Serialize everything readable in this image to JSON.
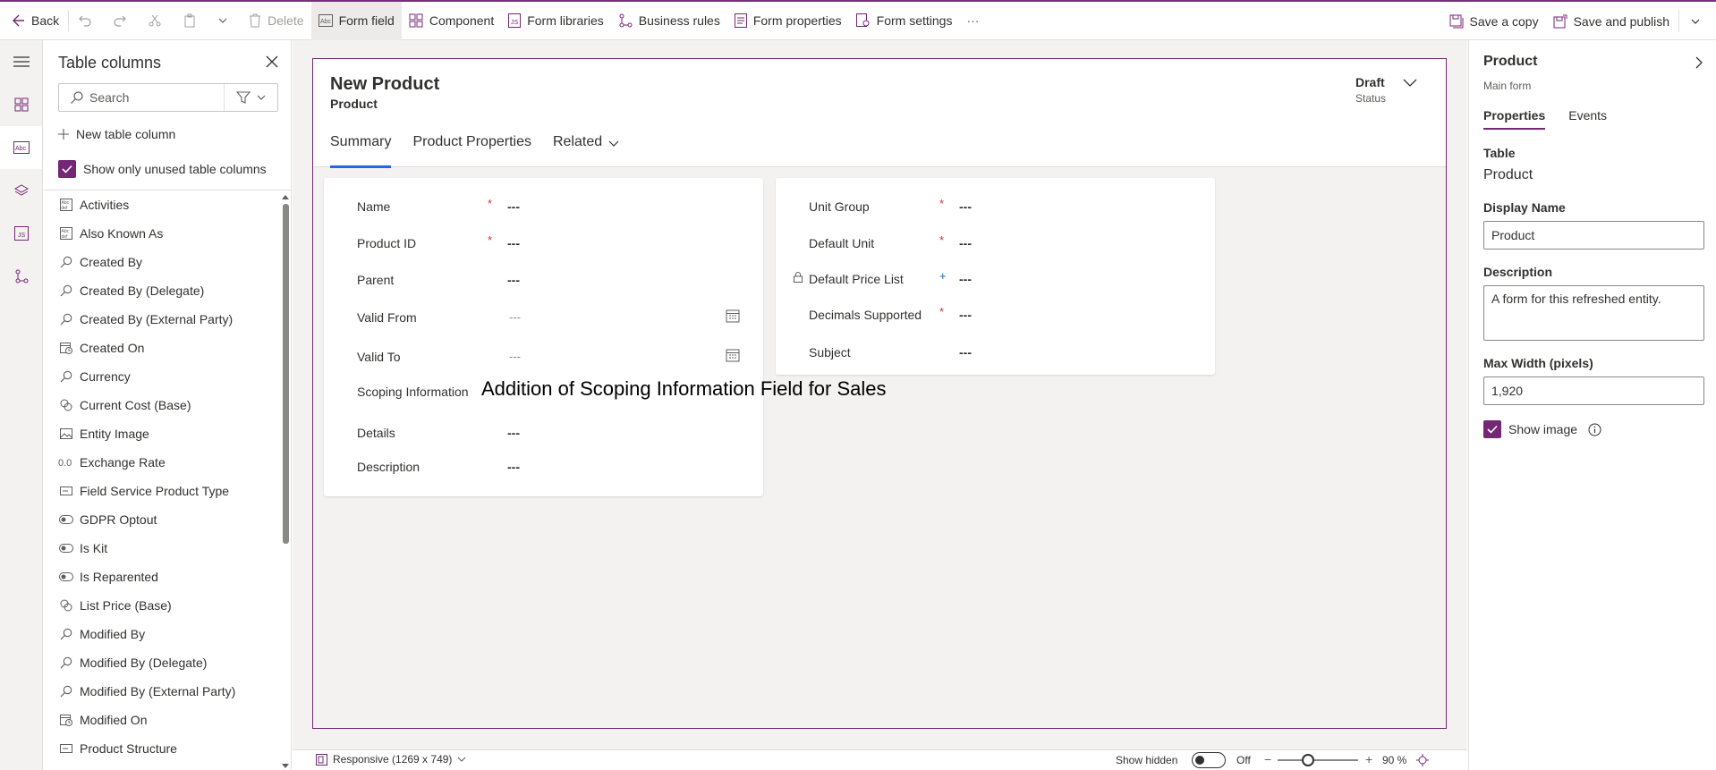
{
  "toolbar": {
    "back": "Back",
    "delete": "Delete",
    "form_field": "Form field",
    "component": "Component",
    "form_libraries": "Form libraries",
    "business_rules": "Business rules",
    "form_properties": "Form properties",
    "form_settings": "Form settings",
    "more": "···",
    "save_copy": "Save a copy",
    "save_publish": "Save and publish"
  },
  "left_panel": {
    "title": "Table columns",
    "search_placeholder": "Search",
    "new_column": "New table column",
    "show_unused": "Show only unused table columns",
    "show_unused_checked": true,
    "columns": [
      {
        "label": "Activities",
        "icon": "text-field-icon"
      },
      {
        "label": "Also Known As",
        "icon": "text-field-icon"
      },
      {
        "label": "Created By",
        "icon": "lookup-icon"
      },
      {
        "label": "Created By (Delegate)",
        "icon": "lookup-icon"
      },
      {
        "label": "Created By (External Party)",
        "icon": "lookup-icon"
      },
      {
        "label": "Created On",
        "icon": "calendar-clock-icon"
      },
      {
        "label": "Currency",
        "icon": "lookup-icon"
      },
      {
        "label": "Current Cost (Base)",
        "icon": "currency-icon"
      },
      {
        "label": "Entity Image",
        "icon": "image-icon"
      },
      {
        "label": "Exchange Rate",
        "icon": "decimal-icon"
      },
      {
        "label": "Field Service Product Type",
        "icon": "choice-icon"
      },
      {
        "label": "GDPR Optout",
        "icon": "toggle-icon"
      },
      {
        "label": "Is Kit",
        "icon": "toggle-icon"
      },
      {
        "label": "Is Reparented",
        "icon": "toggle-icon"
      },
      {
        "label": "List Price (Base)",
        "icon": "currency-icon"
      },
      {
        "label": "Modified By",
        "icon": "lookup-icon"
      },
      {
        "label": "Modified By (Delegate)",
        "icon": "lookup-icon"
      },
      {
        "label": "Modified By (External Party)",
        "icon": "lookup-icon"
      },
      {
        "label": "Modified On",
        "icon": "calendar-clock-icon"
      },
      {
        "label": "Product Structure",
        "icon": "choice-icon"
      }
    ]
  },
  "form": {
    "title": "New Product",
    "entity": "Product",
    "status_value": "Draft",
    "status_label": "Status",
    "tabs": [
      "Summary",
      "Product Properties",
      "Related"
    ],
    "left_fields": [
      {
        "label": "Name",
        "required": "*",
        "value": "---"
      },
      {
        "label": "Product ID",
        "required": "*",
        "value": "---"
      },
      {
        "label": "Parent",
        "required": "",
        "value": "---"
      },
      {
        "label": "Valid From",
        "required": "",
        "value": "---"
      },
      {
        "label": "Valid To",
        "required": "",
        "value": "---"
      },
      {
        "label": "Scoping Information",
        "required": "",
        "value": "Addition of Scoping Information Field for Sales"
      },
      {
        "label": "Details",
        "required": "",
        "value": "---"
      },
      {
        "label": "Description",
        "required": "",
        "value": "---"
      }
    ],
    "right_fields": [
      {
        "label": "Unit Group",
        "required": "*",
        "value": "---"
      },
      {
        "label": "Default Unit",
        "required": "*",
        "value": "---"
      },
      {
        "label": "Default Price List",
        "required": "+",
        "value": "---"
      },
      {
        "label": "Decimals Supported",
        "required": "*",
        "value": "---"
      },
      {
        "label": "Subject",
        "required": "",
        "value": "---"
      }
    ]
  },
  "bottom": {
    "responsive": "Responsive (1269 x 749)",
    "show_hidden": "Show hidden",
    "toggle_state": "Off",
    "zoom_minus": "−",
    "zoom_plus": "+",
    "zoom": "90 %",
    "zoom_fraction": 0.38
  },
  "right_panel": {
    "title": "Product",
    "subtitle": "Main form",
    "tabs": [
      "Properties",
      "Events"
    ],
    "table_label": "Table",
    "table_value": "Product",
    "display_name_label": "Display Name",
    "display_name_value": "Product",
    "description_label": "Description",
    "description_value": "A form for this refreshed entity.",
    "max_width_label": "Max Width (pixels)",
    "max_width_value": "1,920",
    "show_image_label": "Show image",
    "show_image_checked": true
  },
  "colors": {
    "accent": "#742774",
    "tab_underline": "#2266e3",
    "required": "#d13438"
  }
}
